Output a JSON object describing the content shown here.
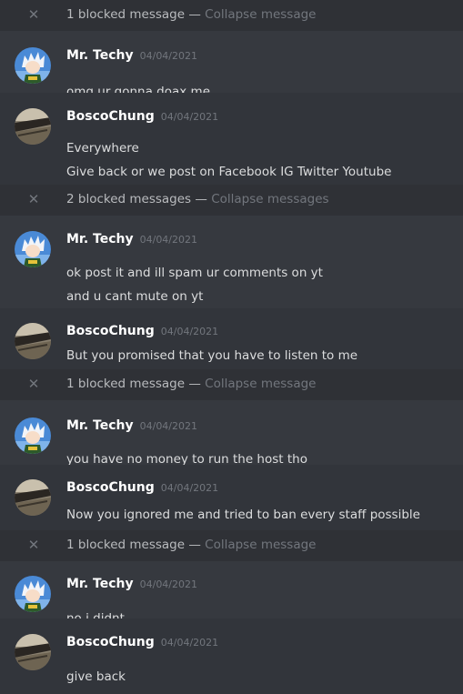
{
  "entries": [
    {
      "kind": "blocked",
      "count_label": "1 blocked message",
      "sep": "—",
      "collapse_label": "Collapse message"
    },
    {
      "kind": "msg",
      "avatar": "techy",
      "author": "Mr. Techy",
      "timestamp": "04/04/2021",
      "lines": [
        "omg ur gonna doax me"
      ]
    },
    {
      "kind": "msg",
      "avatar": "bosco",
      "author": "BoscoChung",
      "timestamp": "04/04/2021",
      "lines": [
        "Everywhere",
        "Give back or we post on Facebook IG Twitter Youtube"
      ]
    },
    {
      "kind": "blocked",
      "count_label": "2 blocked messages",
      "sep": "—",
      "collapse_label": "Collapse messages"
    },
    {
      "kind": "msg",
      "avatar": "techy",
      "author": "Mr. Techy",
      "timestamp": "04/04/2021",
      "lines": [
        "ok post it and ill spam ur comments on yt",
        "and u cant mute on yt"
      ]
    },
    {
      "kind": "msg",
      "avatar": "bosco",
      "author": "BoscoChung",
      "timestamp": "04/04/2021",
      "lines": [
        "But you promised that you have to listen to me"
      ]
    },
    {
      "kind": "blocked",
      "count_label": "1 blocked message",
      "sep": "—",
      "collapse_label": "Collapse message"
    },
    {
      "kind": "msg",
      "avatar": "techy",
      "author": "Mr. Techy",
      "timestamp": "04/04/2021",
      "lines": [
        "you have no money to run the host tho"
      ]
    },
    {
      "kind": "msg",
      "avatar": "bosco",
      "author": "BoscoChung",
      "timestamp": "04/04/2021",
      "lines": [
        "Now you ignored me and tried to ban every staff possible"
      ]
    },
    {
      "kind": "blocked",
      "count_label": "1 blocked message",
      "sep": "—",
      "collapse_label": "Collapse message"
    },
    {
      "kind": "msg",
      "avatar": "techy",
      "author": "Mr. Techy",
      "timestamp": "04/04/2021",
      "lines": [
        "no i didnt"
      ]
    },
    {
      "kind": "msg",
      "avatar": "bosco",
      "author": "BoscoChung",
      "timestamp": "04/04/2021",
      "lines": [
        "give back"
      ]
    }
  ],
  "colors": {
    "background": "#36393f",
    "blocked_bar": "#2f3136",
    "author": "#ffffff",
    "text": "#dcddde",
    "muted": "#72767d"
  },
  "icons": {
    "dismiss": "close-icon",
    "techy_avatar": "anime-character-avatar",
    "bosco_avatar": "landscape-photo-avatar"
  }
}
